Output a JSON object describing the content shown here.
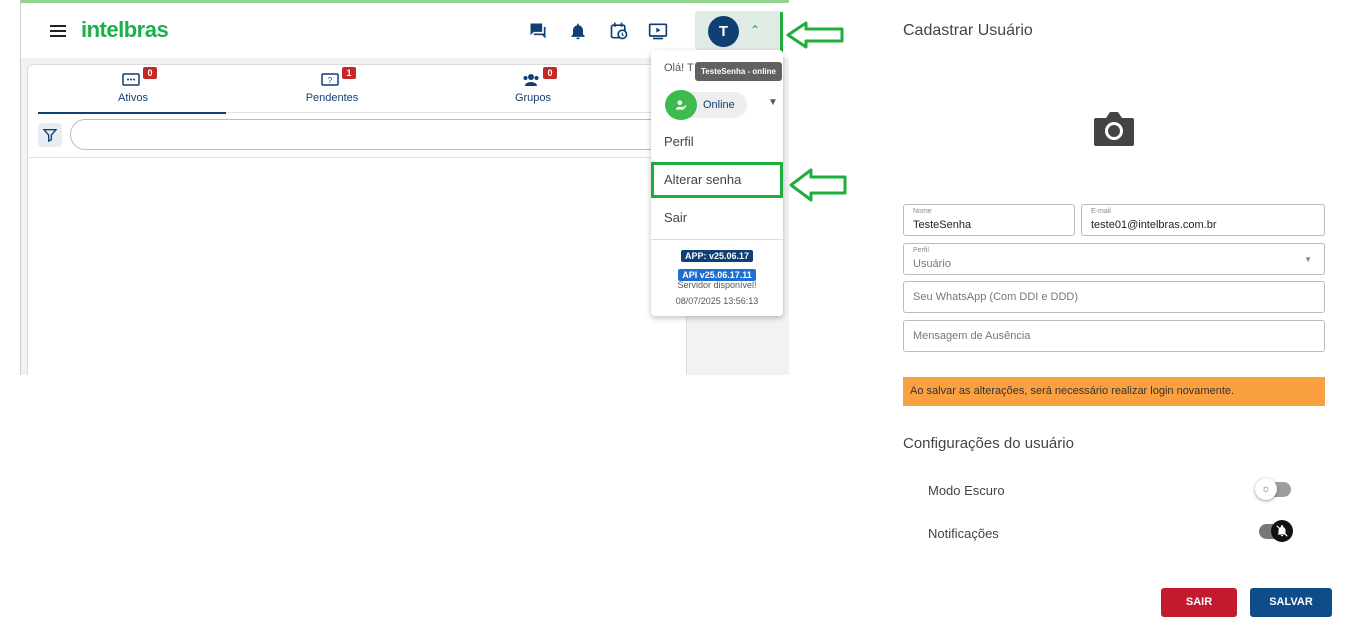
{
  "header": {
    "logo": "intelbras",
    "avatar_initial": "T"
  },
  "tabs": [
    {
      "label": "Ativos",
      "badge": "0",
      "icon": "chat-dots-icon",
      "active": true
    },
    {
      "label": "Pendentes",
      "badge": "1",
      "icon": "question-chat-icon",
      "active": false
    },
    {
      "label": "Grupos",
      "badge": "0",
      "icon": "group-icon",
      "active": false
    }
  ],
  "menu": {
    "greeting": "Olá! T",
    "tooltip": "TesteSenha - online",
    "status": "Online",
    "items": [
      "Perfil",
      "Alterar senha",
      "Sair"
    ],
    "app_version": "APP: v25.06.17",
    "api_version": "API v25.06.17.11",
    "server_status": "Servidor disponível!",
    "timestamp": "08/07/2025 13:56:13"
  },
  "form": {
    "title": "Cadastrar Usuário",
    "name_label": "Nome",
    "name_value": "TesteSenha",
    "email_label": "E-mail",
    "email_value": "teste01@intelbras.com.br",
    "profile_label": "Perfil",
    "profile_value": "Usuário",
    "whatsapp_placeholder": "Seu WhatsApp (Com DDI e DDD)",
    "absence_placeholder": "Mensagem de Ausência",
    "warning": "Ao salvar as alterações, será necessário realizar login novamente.",
    "config_title": "Configurações do usuário",
    "dark_mode_label": "Modo Escuro",
    "notifications_label": "Notificações",
    "dark_mode_on": false,
    "notifications_on": true,
    "sair_button": "SAIR",
    "salvar_button": "SALVAR"
  },
  "colors": {
    "brand_green": "#1ab04a",
    "primary_blue": "#0f3f73",
    "highlight_green": "#1fad3c",
    "warning_orange": "#fba040",
    "danger_red": "#c21a2e"
  }
}
